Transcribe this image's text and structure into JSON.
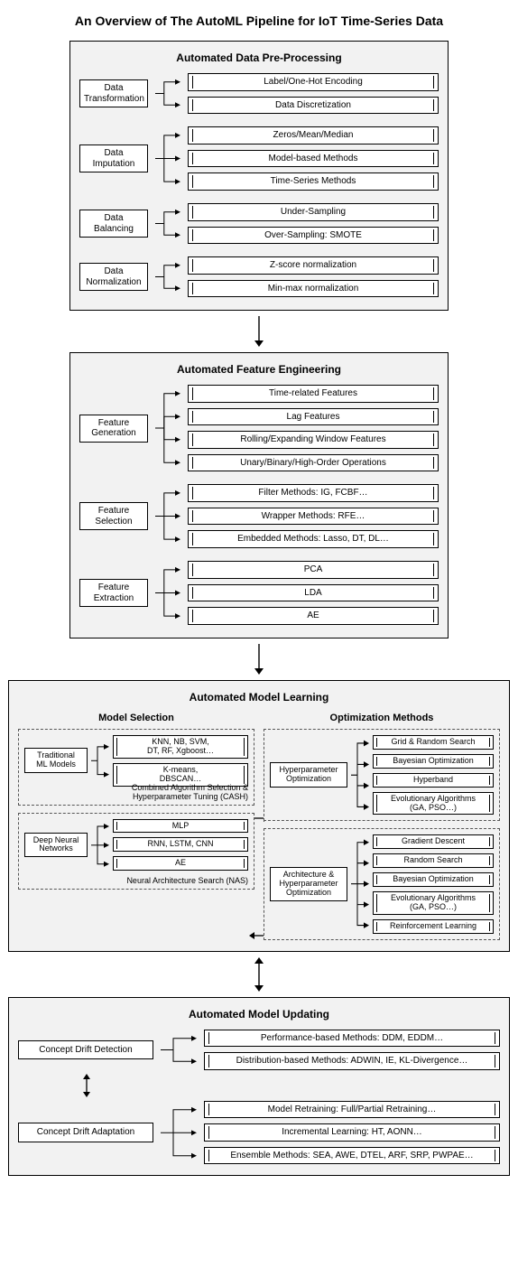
{
  "title": "An Overview of The AutoML Pipeline for IoT Time-Series Data",
  "stage1": {
    "title": "Automated Data Pre-Processing",
    "groups": [
      {
        "src": "Data\nTransformation",
        "targets": [
          "Label/One-Hot Encoding",
          "Data Discretization"
        ]
      },
      {
        "src": "Data\nImputation",
        "targets": [
          "Zeros/Mean/Median",
          "Model-based Methods",
          "Time-Series Methods"
        ]
      },
      {
        "src": "Data\nBalancing",
        "targets": [
          "Under-Sampling",
          "Over-Sampling: SMOTE"
        ]
      },
      {
        "src": "Data\nNormalization",
        "targets": [
          "Z-score normalization",
          "Min-max normalization"
        ]
      }
    ]
  },
  "stage2": {
    "title": "Automated Feature Engineering",
    "groups": [
      {
        "src": "Feature\nGeneration",
        "targets": [
          "Time-related Features",
          "Lag Features",
          "Rolling/Expanding Window Features",
          "Unary/Binary/High-Order Operations"
        ]
      },
      {
        "src": "Feature\nSelection",
        "targets": [
          "Filter Methods: IG, FCBF…",
          "Wrapper Methods: RFE…",
          "Embedded Methods: Lasso, DT, DL…"
        ]
      },
      {
        "src": "Feature\nExtraction",
        "targets": [
          "PCA",
          "LDA",
          "AE"
        ]
      }
    ]
  },
  "stage3": {
    "title": "Automated Model Learning",
    "left_title": "Model Selection",
    "right_title": "Optimization Methods",
    "q1": {
      "src": "Traditional\nML Models",
      "targets": [
        "KNN, NB, SVM,\nDT, RF, Xgboost…",
        "K-means,\nDBSCAN…"
      ],
      "caption": "Combined Algorithm Selection &\nHyperparameter Tuning (CASH)"
    },
    "q2": {
      "src": "Hyperparameter\nOptimization",
      "targets": [
        "Grid & Random Search",
        "Bayesian Optimization",
        "Hyperband",
        "Evolutionary Algorithms\n(GA, PSO…)"
      ]
    },
    "q3": {
      "src": "Deep Neural\nNetworks",
      "targets": [
        "MLP",
        "RNN, LSTM, CNN",
        "AE"
      ],
      "caption": "Neural Architecture Search (NAS)"
    },
    "q4": {
      "src": "Architecture &\nHyperparameter\nOptimization",
      "targets": [
        "Gradient Descent",
        "Random Search",
        "Bayesian Optimization",
        "Evolutionary Algorithms\n(GA, PSO…)",
        "Reinforcement Learning"
      ]
    }
  },
  "stage4": {
    "title": "Automated Model Updating",
    "g1": {
      "src": "Concept Drift Detection",
      "targets": [
        "Performance-based Methods: DDM, EDDM…",
        "Distribution-based Methods: ADWIN, IE, KL-Divergence…"
      ]
    },
    "g2": {
      "src": "Concept Drift Adaptation",
      "targets": [
        "Model Retraining: Full/Partial Retraining…",
        "Incremental Learning: HT, AONN…",
        "Ensemble Methods: SEA, AWE, DTEL, ARF, SRP, PWPAE…"
      ]
    }
  }
}
